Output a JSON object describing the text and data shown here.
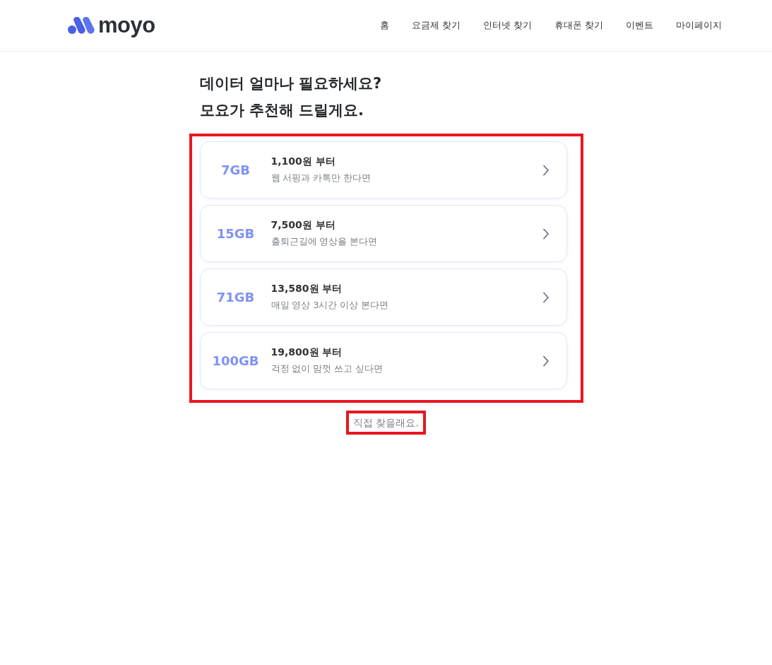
{
  "header": {
    "logo_text": "moyo",
    "nav": [
      {
        "label": "홈"
      },
      {
        "label": "요금제 찾기"
      },
      {
        "label": "인터넷 찾기"
      },
      {
        "label": "휴대폰 찾기"
      },
      {
        "label": "이벤트"
      },
      {
        "label": "마이페이지"
      }
    ]
  },
  "title_lines": [
    "데이터 얼마나 필요하세요?",
    "모요가 추천해 드릴게요."
  ],
  "plans": [
    {
      "data": "7GB",
      "price": "1,100원 부터",
      "description": "웹 서핑과 카톡만 한다면"
    },
    {
      "data": "15GB",
      "price": "7,500원 부터",
      "description": "출퇴근길에 영상을 본다면"
    },
    {
      "data": "71GB",
      "price": "13,580원 부터",
      "description": "매일 영상 3시간 이상 본다면"
    },
    {
      "data": "100GB",
      "price": "19,800원 부터",
      "description": "걱정 없이 맘껏 쓰고 싶다면"
    }
  ],
  "self_search_link": "직접 찾을래요."
}
